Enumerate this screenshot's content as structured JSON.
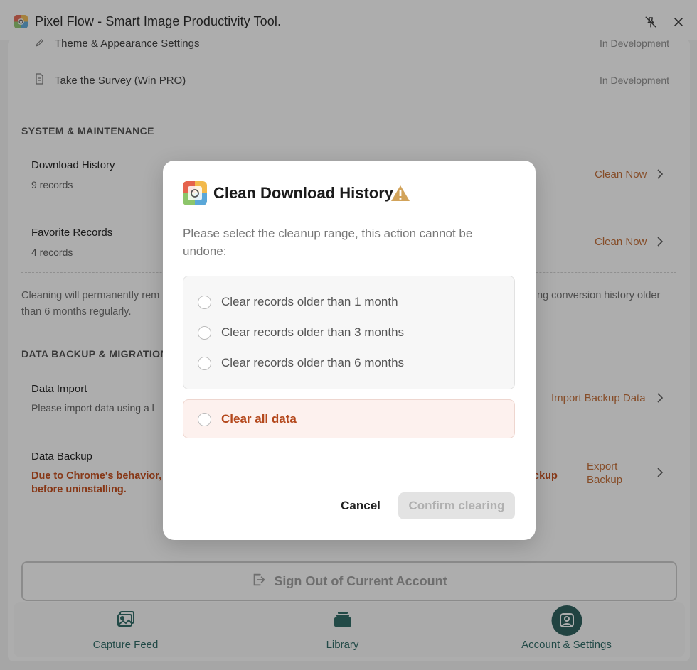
{
  "window": {
    "title": "Pixel Flow - Smart Image Productivity Tool."
  },
  "settings_rows": [
    {
      "label": "Theme & Appearance Settings",
      "status": "In Development"
    },
    {
      "label": "Take the Survey (Win PRO)",
      "status": "In Development"
    }
  ],
  "system": {
    "section_title": "SYSTEM & MAINTENANCE",
    "download_history": {
      "title": "Download History",
      "count": "9 records",
      "action": "Clean Now"
    },
    "favorite_records": {
      "title": "Favorite Records",
      "count": "4 records",
      "action": "Clean Now"
    },
    "note_left": "Cleaning will permanently rem",
    "note_right": "ng conversion history older",
    "note_line2": "than 6 months regularly."
  },
  "backup": {
    "section_title": "DATA BACKUP & MIGRATION",
    "import": {
      "title": "Data Import",
      "sub": "Please import data using a l",
      "action": "Import Backup Data"
    },
    "export": {
      "title": "Data Backup",
      "warn_line1": "Due to Chrome's behavior,",
      "warn_line2": "before uninstalling.",
      "warn_right": "ckup",
      "action_line1": "Export",
      "action_line2": "Backup"
    }
  },
  "signout": {
    "label": "Sign Out of Current Account"
  },
  "nav": {
    "items": [
      {
        "label": "Capture Feed"
      },
      {
        "label": "Library"
      },
      {
        "label": "Account & Settings"
      }
    ]
  },
  "dialog": {
    "title": "Clean Download History",
    "desc_line1": "Please select the cleanup range, this action cannot be",
    "desc_line2": "undone:",
    "options": [
      {
        "label": "Clear records older than 1 month"
      },
      {
        "label": "Clear records older than 3 months"
      },
      {
        "label": "Clear records older than 6 months"
      }
    ],
    "danger_option": "Clear all data",
    "cancel": "Cancel",
    "confirm": "Confirm clearing"
  },
  "colors": {
    "accent_orange": "#c0652a",
    "danger": "#b4481c",
    "nav_teal": "#1e5451"
  },
  "icons": [
    "app-logo-icon",
    "pin-off-icon",
    "close-icon",
    "pencil-icon",
    "survey-icon",
    "chevron-right-icon",
    "warning-icon",
    "sign-out-icon",
    "image-icon",
    "library-stack-icon",
    "account-icon"
  ]
}
